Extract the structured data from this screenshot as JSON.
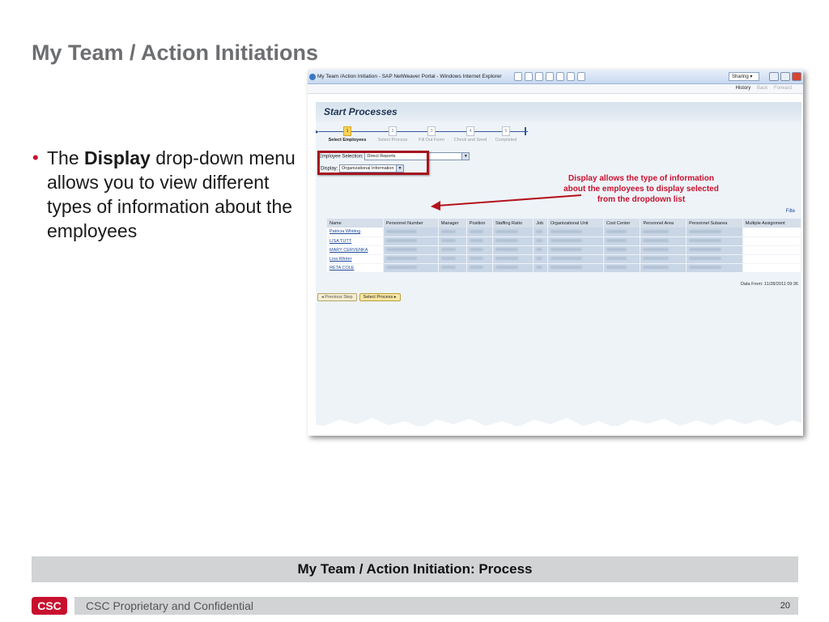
{
  "slide": {
    "title": "My Team / Action Initiations",
    "bullet": {
      "prefix": "The ",
      "bold": "Display",
      "rest": " drop-down menu allows you to view different types of information about the employees"
    },
    "footer_banner": "My Team / Action Initiation: Process",
    "confidential": "CSC Proprietary and Confidential",
    "page_number": "20",
    "logo": "CSC"
  },
  "browser": {
    "window_title": "My Team /Action Initiation - SAP NetWeaver Portal - Windows Internet Explorer",
    "sharing_label": "Sharing",
    "nav": {
      "history": "History",
      "back": "Back",
      "forward": "Forward"
    }
  },
  "sap": {
    "page_title": "Start Processes",
    "steps": [
      {
        "num": "1",
        "label": "Select Employees"
      },
      {
        "num": "2",
        "label": "Select Process"
      },
      {
        "num": "3",
        "label": "Fill Out Form"
      },
      {
        "num": "4",
        "label": "Check and Send"
      },
      {
        "num": "5",
        "label": "Completed"
      }
    ],
    "employee_selection": {
      "label": "Employee Selection:",
      "value": "Direct Reports"
    },
    "display": {
      "label": "Display:",
      "value": "Organizational Information"
    },
    "annotation": "Display allows the type of information about the employees to display selected from the dropdown list",
    "filter_label": "Filte",
    "columns": [
      "Name",
      "Personnel Number",
      "Manager",
      "Position",
      "Staffing Ratio",
      "Job",
      "Organizational Unit",
      "Cost Center",
      "Personnel Area",
      "Personnel Subarea",
      "Multiple Assignment"
    ],
    "employees": [
      "Patricia Whiting",
      "LISA TUTT",
      "MARY CERVENKA",
      "Lisa Winter",
      "RETA COLE"
    ],
    "data_from": "Data From: 11/28/2011 09:36",
    "buttons": {
      "previous": "Previous Step",
      "next": "Select Process"
    }
  }
}
